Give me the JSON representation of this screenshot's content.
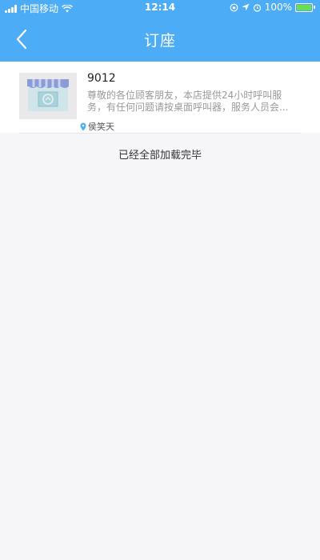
{
  "status_bar": {
    "carrier": "中国移动",
    "time": "12:14",
    "battery": "100%"
  },
  "nav": {
    "title": "订座"
  },
  "list": {
    "items": [
      {
        "title": "9012",
        "description": "尊敬的各位顾客朋友，本店提供24小时呼叫服务，有任何问题请按桌面呼叫器，服务人员会...",
        "location": "侯笑天"
      }
    ],
    "end_message": "已经全部加载完毕"
  },
  "colors": {
    "accent": "#4cacf5",
    "background": "#f6f6f8"
  }
}
